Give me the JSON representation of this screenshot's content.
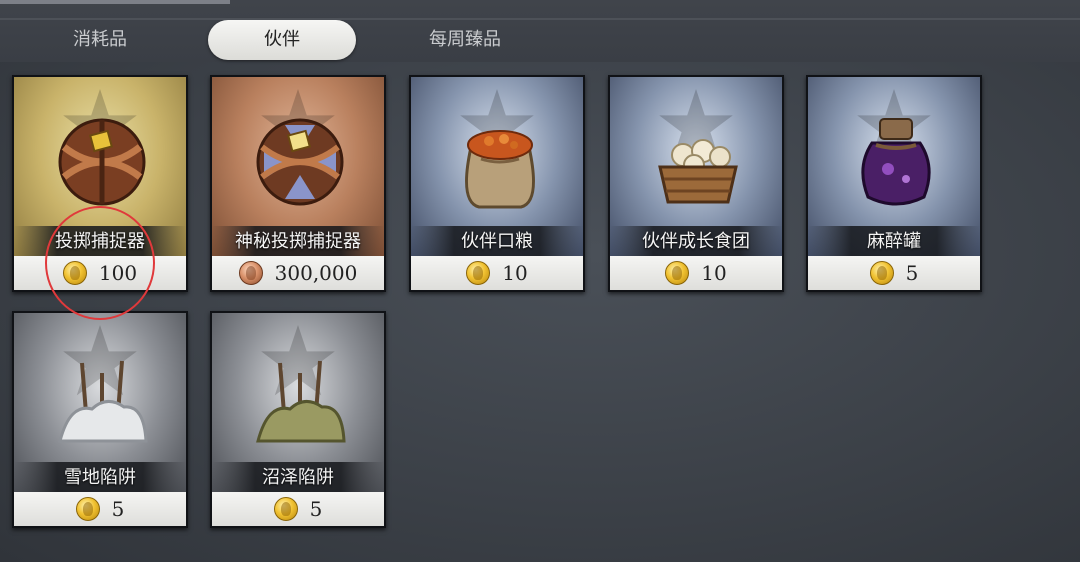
{
  "tabs": [
    {
      "label": "消耗品"
    },
    {
      "label": "伙伴",
      "selected": true
    },
    {
      "label": "每周臻品"
    }
  ],
  "items": [
    {
      "name": "投掷捕捉器",
      "price": "100",
      "coin": "gold-coin-icon",
      "background": "gold"
    },
    {
      "name": "神秘投掷捕捉器",
      "price": "300,000",
      "coin": "copper-coin-icon",
      "background": "copper"
    },
    {
      "name": "伙伴口粮",
      "price": "10",
      "coin": "gold-coin-icon",
      "background": "blue"
    },
    {
      "name": "伙伴成长食团",
      "price": "10",
      "coin": "gold-coin-icon",
      "background": "blue"
    },
    {
      "name": "麻醉罐",
      "price": "5",
      "coin": "gold-coin-icon",
      "background": "blue"
    },
    {
      "name": "雪地陷阱",
      "price": "5",
      "coin": "gold-coin-icon",
      "background": "gray"
    },
    {
      "name": "沼泽陷阱",
      "price": "5",
      "coin": "gold-coin-icon",
      "background": "gray"
    }
  ],
  "colors": {
    "highlight_circle": "#e0393b",
    "selected_tab": "#f0f0ee"
  }
}
